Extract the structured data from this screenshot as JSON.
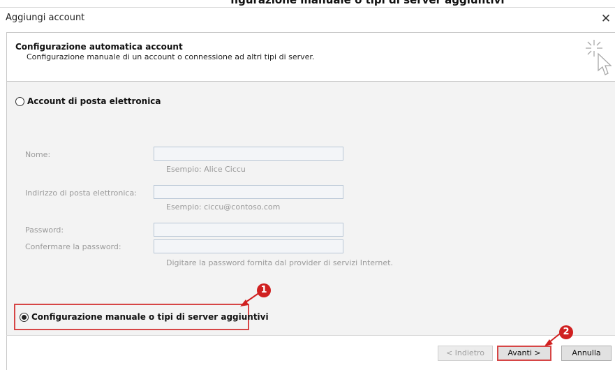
{
  "caption": {
    "text": "figurazione manuale o tipi di server aggiuntivi"
  },
  "window": {
    "title": "Aggiungi account",
    "close_glyph": "✕"
  },
  "header": {
    "title": "Configurazione automatica account",
    "subtitle": "Configurazione manuale di un account o connessione ad altri tipi di server.",
    "icon": "cursor-sparkle-icon"
  },
  "options": {
    "email_account": {
      "label": "Account di posta elettronica",
      "selected": false
    },
    "manual": {
      "label": "Configurazione manuale o tipi di server aggiuntivi",
      "selected": true
    }
  },
  "form": {
    "name": {
      "label": "Nome:",
      "value": "",
      "hint": "Esempio: Alice Ciccu"
    },
    "email": {
      "label": "Indirizzo di posta elettronica:",
      "value": "",
      "hint": "Esempio: ciccu@contoso.com"
    },
    "password": {
      "label": "Password:",
      "value": ""
    },
    "confirm_password": {
      "label": "Confermare la password:",
      "value": "",
      "hint": "Digitare la password fornita dal provider di servizi Internet."
    }
  },
  "annotations": {
    "badge1": "1",
    "badge2": "2",
    "color": "#d02020"
  },
  "buttons": {
    "back": "< Indietro",
    "next": "Avanti >",
    "cancel": "Annulla"
  }
}
